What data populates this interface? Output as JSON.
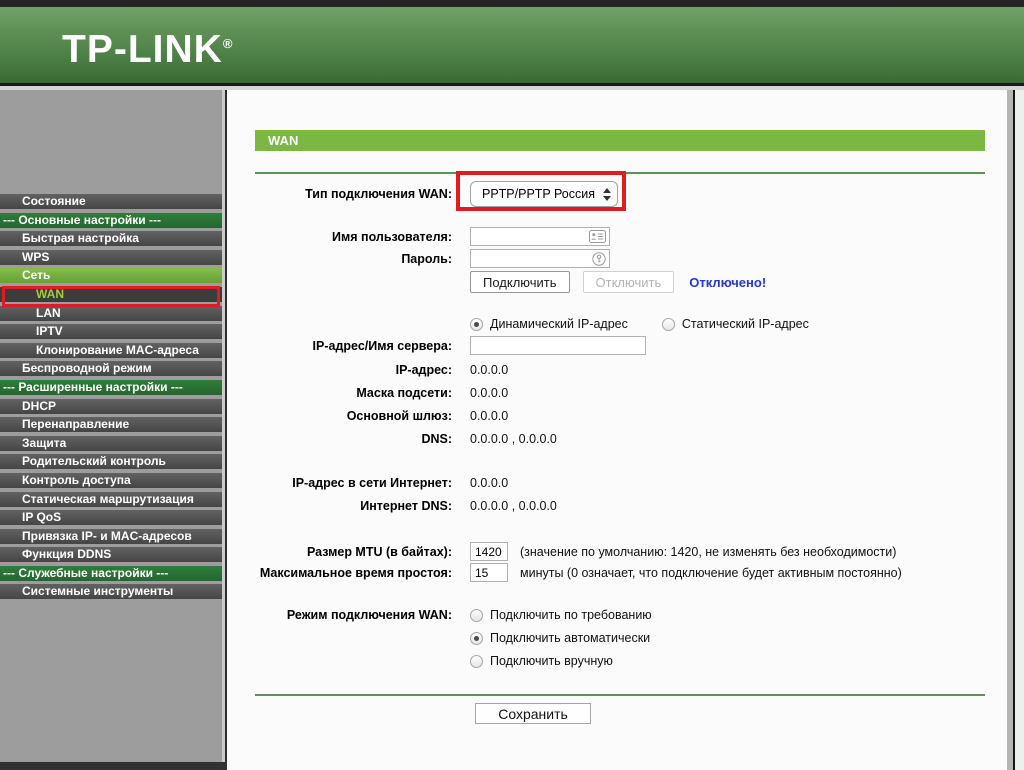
{
  "header": {
    "logo": "TP-LINK",
    "reg": "®"
  },
  "sidebar": {
    "items": [
      {
        "label": "Состояние"
      },
      {
        "label": "--- Основные настройки ---"
      },
      {
        "label": "Быстрая настройка"
      },
      {
        "label": "WPS"
      },
      {
        "label": "Сеть"
      },
      {
        "label": "WAN"
      },
      {
        "label": "LAN"
      },
      {
        "label": "IPTV"
      },
      {
        "label": "Клонирование MAC-адреса"
      },
      {
        "label": "Беспроводной режим"
      },
      {
        "label": "--- Расширенные настройки ---"
      },
      {
        "label": "DHCP"
      },
      {
        "label": "Перенаправление"
      },
      {
        "label": "Защита"
      },
      {
        "label": "Родительский контроль"
      },
      {
        "label": "Контроль доступа"
      },
      {
        "label": "Статическая маршрутизация"
      },
      {
        "label": "IP QoS"
      },
      {
        "label": "Привязка IP- и MAC-адресов"
      },
      {
        "label": "Функция DDNS"
      },
      {
        "label": "--- Служебные настройки ---"
      },
      {
        "label": "Системные инструменты"
      }
    ]
  },
  "main": {
    "title": "WAN"
  },
  "form": {
    "wan_type_label": "Тип подключения WAN:",
    "wan_type_value": "PPTP/PPTP Россия",
    "username_label": "Имя пользователя:",
    "username_value": "",
    "password_label": "Пароль:",
    "password_value": "",
    "connect_btn": "Подключить",
    "disconnect_btn": "Отключить",
    "status_text": "Отключено!",
    "ip_type_options": [
      "Динамический IP-адрес",
      "Статический IP-адрес"
    ],
    "ip_type_selected": 0,
    "server_label": "IP-адрес/Имя сервера:",
    "server_value": "",
    "ip_label": "IP-адрес:",
    "ip_value": "0.0.0.0",
    "mask_label": "Маска подсети:",
    "mask_value": "0.0.0.0",
    "gateway_label": "Основной шлюз:",
    "gateway_value": "0.0.0.0",
    "dns_label": "DNS:",
    "dns_value": "0.0.0.0 , 0.0.0.0",
    "inet_ip_label": "IP-адрес в сети Интернет:",
    "inet_ip_value": "0.0.0.0",
    "inet_dns_label": "Интернет DNS:",
    "inet_dns_value": "0.0.0.0 , 0.0.0.0",
    "mtu_label": "Размер MTU (в байтах):",
    "mtu_value": "1420",
    "mtu_note": "(значение по умолчанию: 1420, не изменять без необходимости)",
    "idle_label": "Максимальное время простоя:",
    "idle_value": "15",
    "idle_note": "минуты (0 означает, что подключение будет активным постоянно)",
    "mode_label": "Режим подключения WAN:",
    "mode_options": [
      "Подключить по требованию",
      "Подключить автоматически",
      "Подключить вручную"
    ],
    "mode_selected": 1,
    "save_btn": "Сохранить"
  },
  "colors": {
    "brand_green": "#497c43",
    "title_bar_green": "#7bb843",
    "highlight_red": "#e01b22",
    "status_blue": "#2336d4",
    "active_item_text": "#9bd23c"
  }
}
